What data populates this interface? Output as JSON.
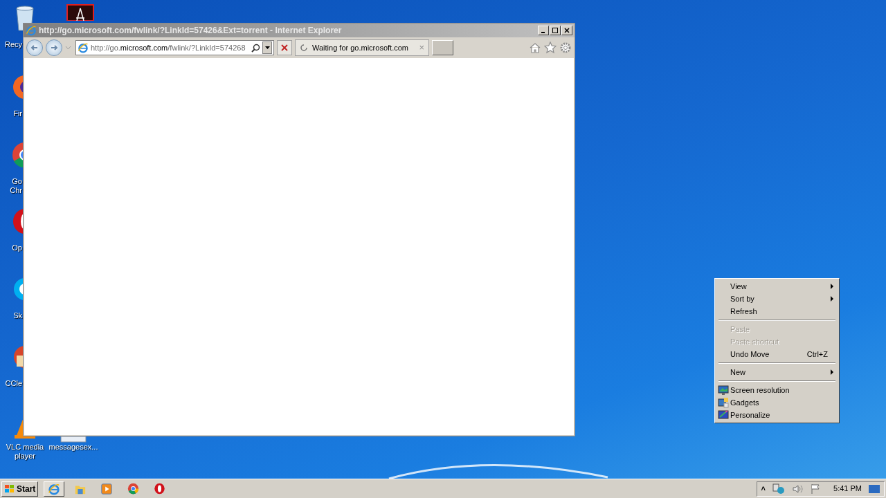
{
  "desktop_icons": [
    {
      "kind": "recycle",
      "lines": [
        "Recy"
      ]
    },
    {
      "kind": "pdf"
    },
    {
      "kind": "firefox",
      "lines": [
        "Fir"
      ]
    },
    {
      "kind": "chrome",
      "lines": [
        "Go",
        "Chr"
      ]
    },
    {
      "kind": "opera",
      "lines": [
        "Op"
      ]
    },
    {
      "kind": "skype",
      "lines": [
        "Sk"
      ]
    },
    {
      "kind": "ccleaner",
      "lines": [
        "CCle"
      ]
    },
    {
      "kind": "vlc",
      "lines": [
        "VLC media",
        "player"
      ]
    },
    {
      "kind": "file",
      "lines": [
        "messagesex..."
      ]
    }
  ],
  "browser": {
    "title": "http://go.microsoft.com/fwlink/?LinkId=57426&Ext=torrent - Internet Explorer",
    "address": {
      "pre": "http://go.",
      "host": "microsoft.com",
      "post": "/fwlink/?LinkId=574268"
    },
    "tabs": [
      {
        "label": "Waiting for go.microsoft.com",
        "selected": true,
        "close": "×"
      }
    ]
  },
  "context_menu": [
    {
      "kind": "item",
      "label": "View",
      "disabled": false,
      "submenu": true
    },
    {
      "kind": "item",
      "label": "Sort by",
      "disabled": false,
      "submenu": true
    },
    {
      "kind": "item",
      "label": "Refresh",
      "disabled": false,
      "submenu": false
    },
    {
      "kind": "separator"
    },
    {
      "kind": "item",
      "label": "Paste",
      "disabled": true,
      "submenu": false
    },
    {
      "kind": "item",
      "label": "Paste shortcut",
      "disabled": true,
      "submenu": false
    },
    {
      "kind": "item",
      "label": "Undo Move",
      "disabled": false,
      "submenu": false,
      "shortcut": "Ctrl+Z"
    },
    {
      "kind": "separator"
    },
    {
      "kind": "item",
      "label": "New",
      "disabled": false,
      "submenu": true
    },
    {
      "kind": "separator"
    },
    {
      "kind": "item",
      "label": "Screen resolution",
      "disabled": false,
      "submenu": false
    },
    {
      "kind": "item",
      "label": "Gadgets",
      "disabled": false,
      "submenu": false
    },
    {
      "kind": "item",
      "label": "Personalize",
      "disabled": false,
      "submenu": false
    }
  ],
  "taskbar": {
    "start": "Start",
    "apps": [
      {
        "kind": "ie",
        "selected": true
      },
      {
        "kind": "explorer",
        "selected": false
      },
      {
        "kind": "media",
        "selected": false
      },
      {
        "kind": "chrome",
        "selected": false
      },
      {
        "kind": "opera",
        "selected": false
      }
    ],
    "tray_arrow": "˄",
    "clock": "5:41 PM"
  }
}
